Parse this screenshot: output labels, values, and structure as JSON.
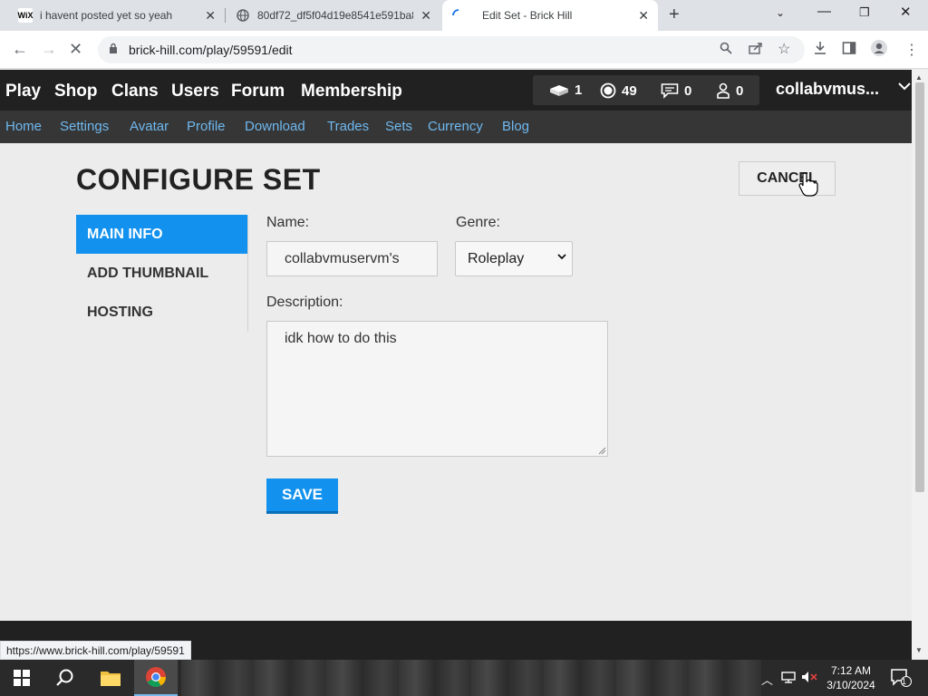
{
  "browser": {
    "tabs": [
      {
        "title": "i havent posted yet so yeah",
        "favicon": "wix-icon",
        "fav_text": "WiX"
      },
      {
        "title": "80df72_df5f04d19e8541e591ba8",
        "favicon": "globe-icon"
      },
      {
        "title": "Edit Set - Brick Hill",
        "favicon": "loading-spinner-icon"
      }
    ],
    "new_tab_symbol": "+",
    "url": "brick-hill.com/play/59591/edit",
    "status_url": "https://www.brick-hill.com/play/59591"
  },
  "site": {
    "main_nav": [
      "Play",
      "Shop",
      "Clans",
      "Users",
      "Forum",
      "Membership"
    ],
    "stats": {
      "bricks": "1",
      "bits": "49",
      "messages": "0",
      "friends": "0"
    },
    "username": "collabvmus...",
    "sub_nav": [
      "Home",
      "Settings",
      "Avatar",
      "Profile",
      "Download",
      "Trades",
      "Sets",
      "Currency",
      "Blog"
    ]
  },
  "form": {
    "title": "CONFIGURE SET",
    "cancel_label": "CANCEL",
    "side_tabs": [
      "MAIN INFO",
      "ADD THUMBNAIL",
      "HOSTING"
    ],
    "name_label": "Name:",
    "name_value": "collabvmuservm's",
    "genre_label": "Genre:",
    "genre_value": "Roleplay",
    "description_label": "Description:",
    "description_value": "idk how to do this",
    "save_label": "SAVE"
  },
  "taskbar": {
    "time": "7:12 AM",
    "date": "3/10/2024",
    "notification_count": "1"
  },
  "colors": {
    "accent_blue": "#1292ee",
    "nav_dark": "#212121",
    "subnav_link": "#6fb8ef"
  }
}
